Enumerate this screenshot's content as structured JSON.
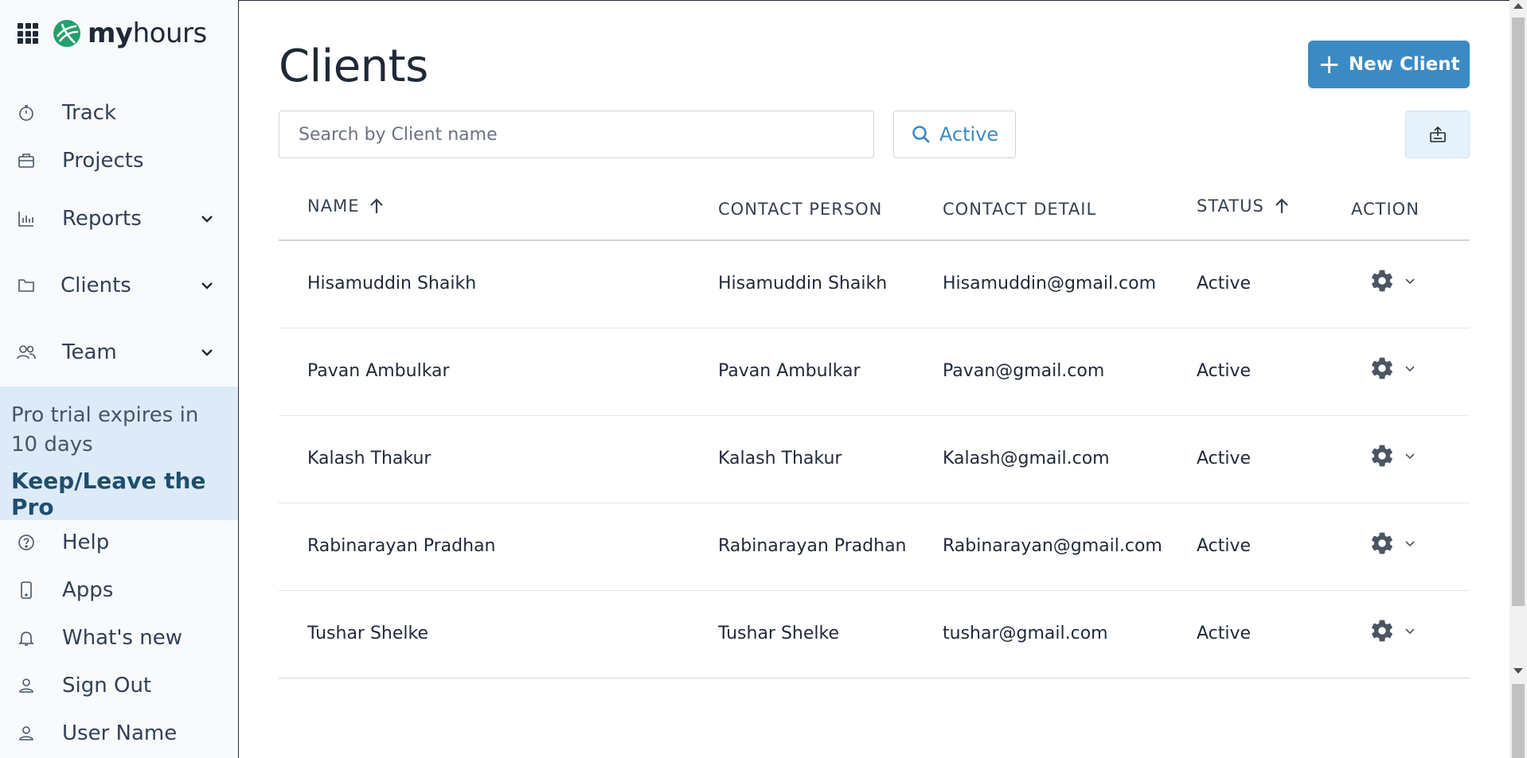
{
  "brand": {
    "name_bold": "my",
    "name_light": "hours"
  },
  "sidebar": {
    "items": [
      {
        "label": "Track",
        "icon": "stopwatch-icon"
      },
      {
        "label": "Projects",
        "icon": "briefcase-icon"
      },
      {
        "label": "Reports",
        "icon": "bar-chart-icon",
        "expandable": true
      },
      {
        "label": "Clients",
        "icon": "folder-icon",
        "expandable": true
      },
      {
        "label": "Team",
        "icon": "users-icon",
        "expandable": true
      },
      {
        "label": "Help",
        "icon": "help-circle-icon"
      },
      {
        "label": "Apps",
        "icon": "mobile-icon"
      },
      {
        "label": "What's new",
        "icon": "bell-icon"
      },
      {
        "label": "Sign Out",
        "icon": "user-icon"
      },
      {
        "label": "User Name",
        "icon": "user-icon"
      }
    ],
    "promo": {
      "text": "Pro trial expires in 10 days",
      "link": "Keep/Leave the Pro"
    }
  },
  "main": {
    "title": "Clients",
    "new_button": {
      "plus": "+",
      "label": "New Client"
    },
    "search": {
      "placeholder": "Search by Client name",
      "value": ""
    },
    "filter": {
      "label": "Active"
    },
    "columns": {
      "name": "NAME",
      "contact_person": "CONTACT PERSON",
      "contact_detail": "CONTACT DETAIL",
      "status": "STATUS",
      "action": "ACTION"
    },
    "rows": [
      {
        "name": "Hisamuddin Shaikh",
        "contact_person": "Hisamuddin Shaikh",
        "contact_detail": "Hisamuddin@gmail.com",
        "status": "Active"
      },
      {
        "name": "Pavan Ambulkar",
        "contact_person": "Pavan Ambulkar",
        "contact_detail": "Pavan@gmail.com",
        "status": "Active"
      },
      {
        "name": "Kalash Thakur",
        "contact_person": "Kalash Thakur",
        "contact_detail": "Kalash@gmail.com",
        "status": "Active"
      },
      {
        "name": "Rabinarayan Pradhan",
        "contact_person": "Rabinarayan Pradhan",
        "contact_detail": "Rabinarayan@gmail.com",
        "status": "Active"
      },
      {
        "name": "Tushar Shelke",
        "contact_person": "Tushar Shelke",
        "contact_detail": "tushar@gmail.com",
        "status": "Active"
      }
    ]
  },
  "colors": {
    "accent": "#3b8ac4",
    "logo": "#22a06b",
    "sidebar_bg": "#f8fafc",
    "promo_bg": "#dcebf7"
  }
}
